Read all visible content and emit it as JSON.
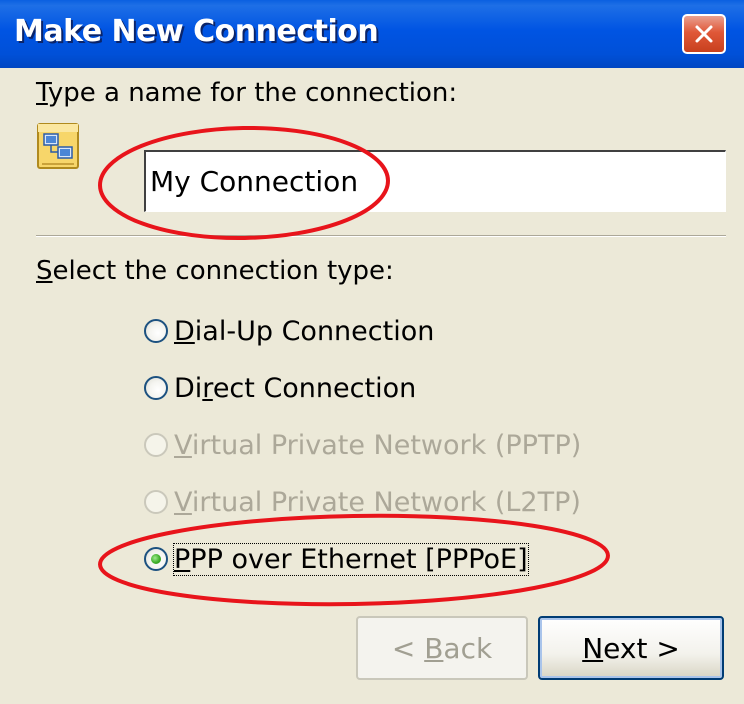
{
  "window": {
    "title": "Make New Connection",
    "close_glyph": "×",
    "accent_color": "#0054E3"
  },
  "name_section": {
    "label_mnemonic": "T",
    "label_rest": "ype a name for the connection:",
    "icon": "network-connection-icon",
    "value": "My Connection"
  },
  "type_section": {
    "label_mnemonic": "S",
    "label_rest": "elect the connection type:"
  },
  "connection_types": [
    {
      "pre": "",
      "mnemonic": "D",
      "rest": "ial-Up Connection",
      "checked": false,
      "enabled": true
    },
    {
      "pre": "Di",
      "mnemonic": "r",
      "rest": "ect Connection",
      "checked": false,
      "enabled": true
    },
    {
      "pre": "",
      "mnemonic": "V",
      "rest": "irtual Private Network (PPTP)",
      "checked": false,
      "enabled": false
    },
    {
      "pre": "",
      "mnemonic": "V",
      "rest": "irtual Private Network (L2TP)",
      "checked": false,
      "enabled": false
    },
    {
      "pre": "",
      "mnemonic": "P",
      "rest": "PP over Ethernet [PPPoE]",
      "checked": true,
      "enabled": true
    }
  ],
  "buttons": {
    "back_pre": "< ",
    "back_mnemonic": "B",
    "back_rest": "ack",
    "next_mnemonic": "N",
    "next_rest": "ext >"
  },
  "annotation_color": "#E8141B"
}
